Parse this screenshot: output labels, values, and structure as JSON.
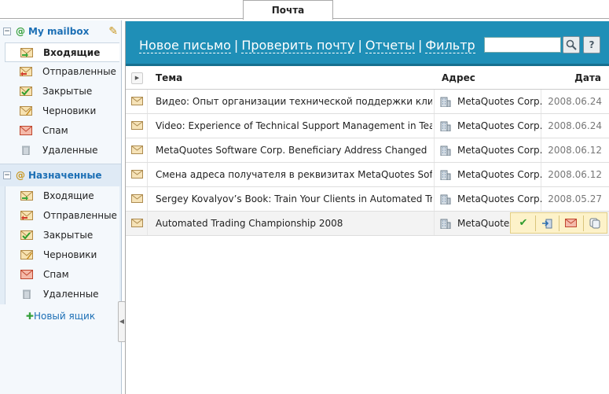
{
  "tab": {
    "label": "Почта"
  },
  "sidebar": {
    "mailbox1": {
      "title": "My mailbox",
      "folders": [
        "Входящие",
        "Отправленные",
        "Закрытые",
        "Черновики",
        "Спам",
        "Удаленные"
      ]
    },
    "mailbox2": {
      "title": "Назначенные",
      "folders": [
        "Входящие",
        "Отправленные",
        "Закрытые",
        "Черновики",
        "Спам",
        "Удаленные"
      ]
    },
    "new_box": "Новый ящик"
  },
  "toolbar": {
    "links": [
      "Новое письмо",
      "Проверить почту",
      "Отчеты",
      "Фильтр"
    ],
    "separator": "|",
    "search_placeholder": "",
    "search_btn": "Q",
    "help_btn": "?"
  },
  "table": {
    "headers": {
      "subject": "Тема",
      "address": "Адрес",
      "date": "Дата"
    },
    "rows": [
      {
        "subject": "Видео: Опыт организации технической поддержки клиенто",
        "address": "MetaQuotes Corp.",
        "date": "2008.06.24"
      },
      {
        "subject": "Video: Experience of Technical Support Management in Team",
        "address": "MetaQuotes Corp.",
        "date": "2008.06.24"
      },
      {
        "subject": "MetaQuotes Software Corp. Beneficiary Address Changed",
        "address": "MetaQuotes Corp.",
        "date": "2008.06.12"
      },
      {
        "subject": "Смена адреса получателя в реквизитах MetaQuotes Softwa",
        "address": "MetaQuotes Corp.",
        "date": "2008.06.12"
      },
      {
        "subject": "Sergey Kovalyov’s Book: Train Your Clients in Automated Trad",
        "address": "MetaQuotes Corp.",
        "date": "2008.05.27"
      },
      {
        "subject": "Automated Trading Championship 2008",
        "address": "MetaQuotes",
        "date": ""
      }
    ]
  },
  "icons": {
    "envelope": "envelope-icon",
    "building": "building-icon",
    "check": "check-icon",
    "forward": "forward-icon",
    "spam": "spam-icon",
    "copy": "copy-icon"
  }
}
